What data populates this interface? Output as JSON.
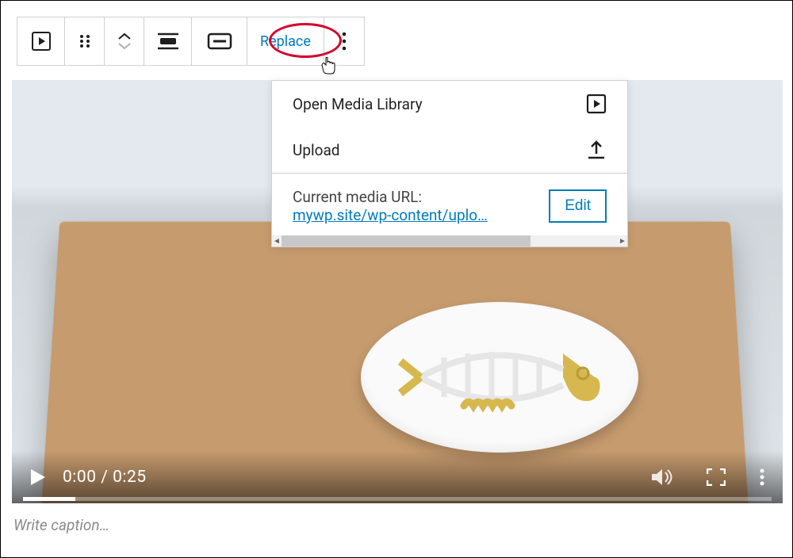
{
  "toolbar": {
    "replace_label": "Replace"
  },
  "dropdown": {
    "open_media_label": "Open Media Library",
    "upload_label": "Upload",
    "current_url_label": "Current media URL:",
    "current_url_text": "mywp.site/wp-content/uplo…",
    "edit_label": "Edit"
  },
  "video": {
    "time_current": "0:00",
    "time_sep": " / ",
    "time_total": "0:25"
  },
  "caption_placeholder": "Write caption…"
}
